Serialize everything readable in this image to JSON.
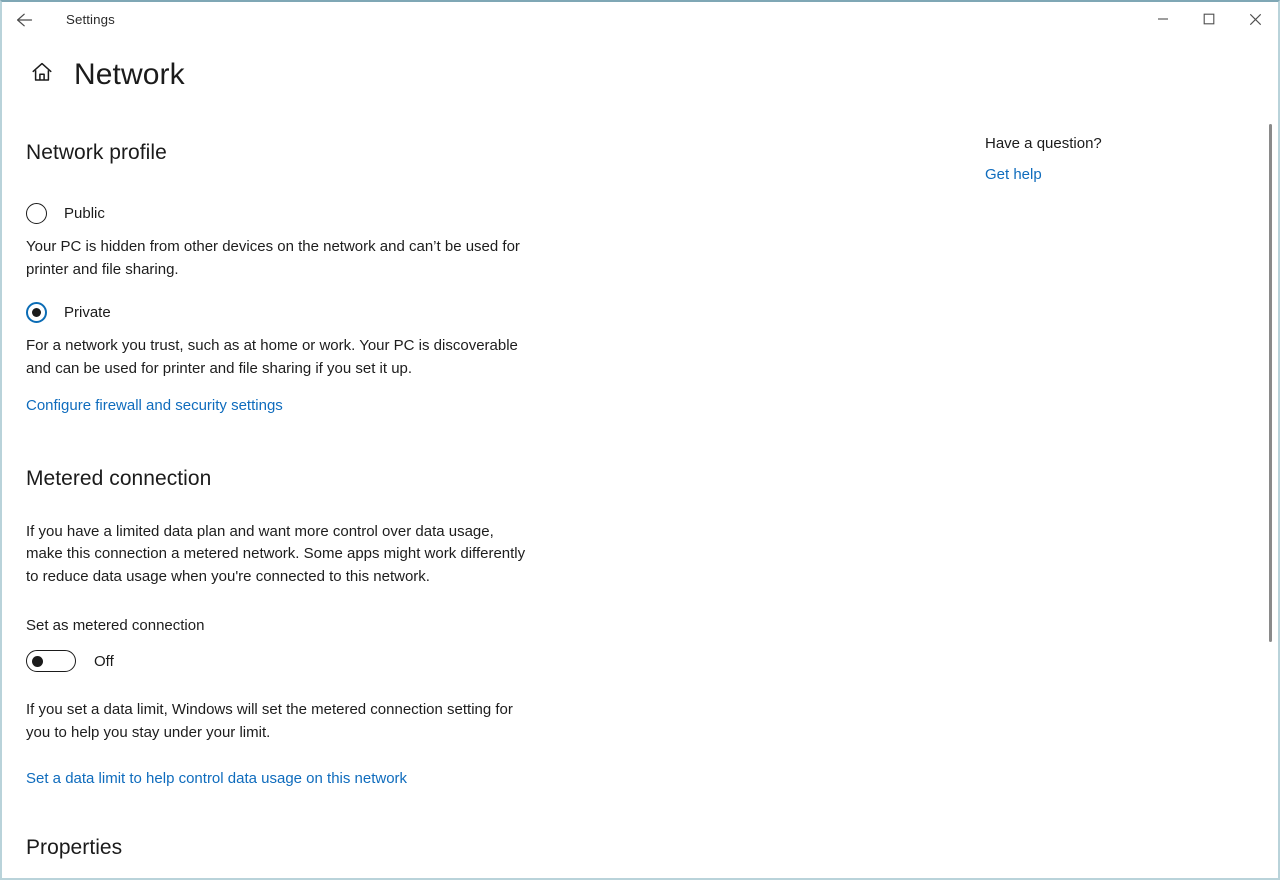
{
  "window": {
    "app_title": "Settings",
    "back_icon": "back-arrow-icon",
    "minimize_label": "Minimize",
    "maximize_label": "Maximize",
    "close_label": "Close"
  },
  "header": {
    "home_icon": "home-icon",
    "page_title": "Network"
  },
  "network_profile": {
    "heading": "Network profile",
    "options": [
      {
        "label": "Public",
        "selected": false,
        "description": "Your PC is hidden from other devices on the network and can’t be used for printer and file sharing."
      },
      {
        "label": "Private",
        "selected": true,
        "description": "For a network you trust, such as at home or work. Your PC is discoverable and can be used for printer and file sharing if you set it up."
      }
    ],
    "link": "Configure firewall and security settings"
  },
  "metered_connection": {
    "heading": "Metered connection",
    "description": "If you have a limited data plan and want more control over data usage, make this connection a metered network. Some apps might work differently to reduce data usage when you're connected to this network.",
    "toggle_label": "Set as metered connection",
    "toggle_state": "Off",
    "toggle_on": false,
    "note": "If you set a data limit, Windows will set the metered connection setting for you to help you stay under your limit.",
    "link": "Set a data limit to help control data usage on this network"
  },
  "properties": {
    "heading": "Properties"
  },
  "help": {
    "title": "Have a question?",
    "link": "Get help"
  },
  "colors": {
    "link": "#0f6cbd",
    "accent": "#0b6cb5",
    "text": "#1b1b1b",
    "window_border": "#b9d3da"
  }
}
